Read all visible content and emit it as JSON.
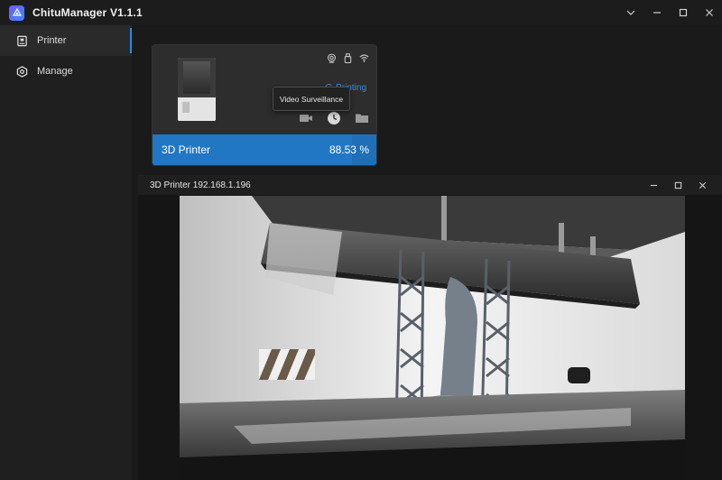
{
  "app": {
    "title": "ChituManager V1.1.1"
  },
  "sidebar": {
    "items": [
      {
        "label": "Printer",
        "icon": "printer-icon",
        "active": true
      },
      {
        "label": "Manage",
        "icon": "hexagon-settings-icon",
        "active": false
      }
    ]
  },
  "printer_card": {
    "status": "Printing",
    "tooltip": "Video Surveillance",
    "name": "3D Printer",
    "progress_text": "88.53 %",
    "progress": 88.53
  },
  "camera_window": {
    "title": "3D Printer 192.168.1.196"
  },
  "colors": {
    "accent": "#2b8ae6",
    "progress_bar": "#1e6fb8",
    "status": "#2f8fe8"
  }
}
